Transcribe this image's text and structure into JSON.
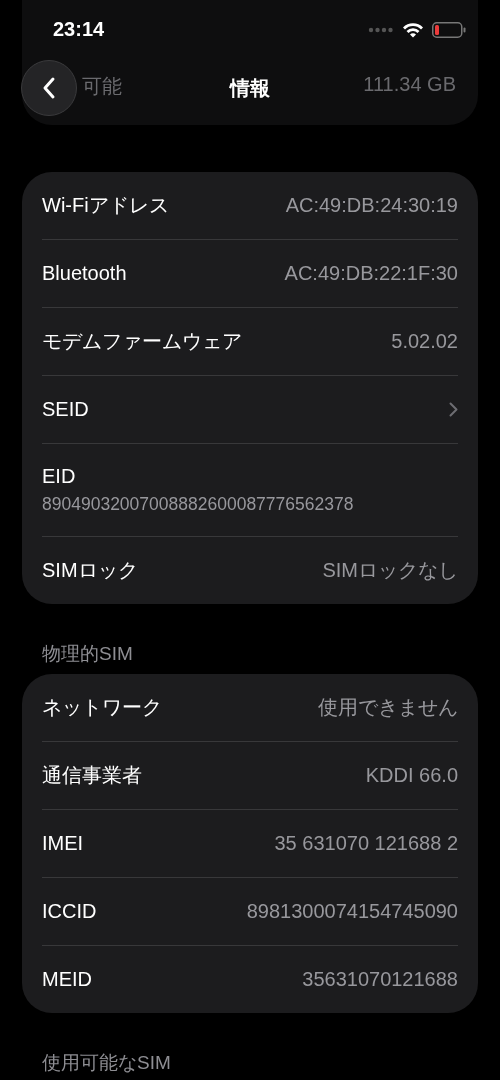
{
  "status_bar": {
    "time": "23:14"
  },
  "background_row": {
    "label": "可能",
    "value": "111.34 GB"
  },
  "nav": {
    "title": "情報"
  },
  "sections": [
    {
      "rows": [
        {
          "kind": "value",
          "label": "Wi-Fiアドレス",
          "value": "AC:49:DB:24:30:19"
        },
        {
          "kind": "value",
          "label": "Bluetooth",
          "value": "AC:49:DB:22:1F:30"
        },
        {
          "kind": "value",
          "label": "モデムファームウェア",
          "value": "5.02.02"
        },
        {
          "kind": "chevron",
          "label": "SEID"
        },
        {
          "kind": "stacked",
          "label": "EID",
          "value": "89049032007008882600087776562378"
        },
        {
          "kind": "value",
          "label": "SIMロック",
          "value": "SIMロックなし"
        }
      ]
    },
    {
      "header": "物理的SIM",
      "rows": [
        {
          "kind": "value",
          "label": "ネットワーク",
          "value": "使用できません"
        },
        {
          "kind": "value",
          "label": "通信事業者",
          "value": "KDDI 66.0"
        },
        {
          "kind": "value",
          "label": "IMEI",
          "value": "35 631070 121688 2"
        },
        {
          "kind": "value",
          "label": "ICCID",
          "value": "8981300074154745090"
        },
        {
          "kind": "value",
          "label": "MEID",
          "value": "35631070121688"
        }
      ]
    },
    {
      "header": "使用可能なSIM"
    }
  ]
}
